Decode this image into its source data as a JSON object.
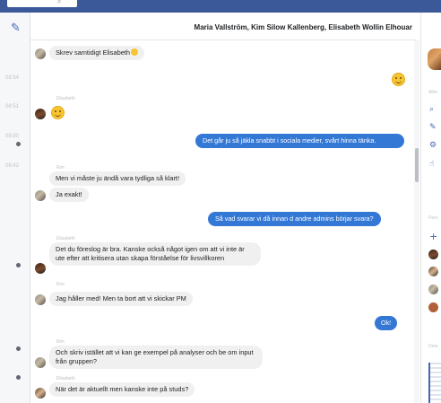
{
  "header": {
    "title": "Maria Vallström, Kim Silow Kallenberg, Elisabeth Wollin Elhouar"
  },
  "leftcol": {
    "times": [
      "08:54",
      "08:51",
      "08:50",
      "08:42"
    ],
    "icons": [
      "compose-icon"
    ]
  },
  "thread": {
    "messages": [
      {
        "text": "Skrev samtidigt Elisabeth"
      },
      {
        "sender": "Elisabeth"
      },
      {
        "text": "Det går ju så jäkla snabbt i sociala medier, svårt hinna tänka."
      },
      {
        "sender": "Kim",
        "text": "Men vi måste ju ändå vara tydliga så klart!"
      },
      {
        "text": "Ja exakt!"
      },
      {
        "text": "Så vad svarar vi då innan d andre admins börjar svara?"
      },
      {
        "sender": "Elisabeth",
        "text": "Det du föreslog är bra. Kanske också något igen om att vi inte är ute efter att kritisera utan skapa förståelse för livsvillkoren"
      },
      {
        "sender": "Kim",
        "text": "Jag håller med! Men ta bort att vi skickar PM"
      },
      {
        "text": "Ok!"
      },
      {
        "sender": "Kim",
        "text": "Och skriv istället att vi kan ge exempel på analyser och be om input från gruppen?"
      },
      {
        "sender": "Elisabeth",
        "text": "När det är aktuellt men kanske inte på studs?"
      }
    ]
  },
  "rightcol": {
    "labels": [
      "Alter",
      "Pers",
      "Dela"
    ],
    "icons": [
      "search-icon",
      "pencil-icon",
      "settings-icon",
      "thumbs-up-icon",
      "add-person-icon"
    ]
  }
}
